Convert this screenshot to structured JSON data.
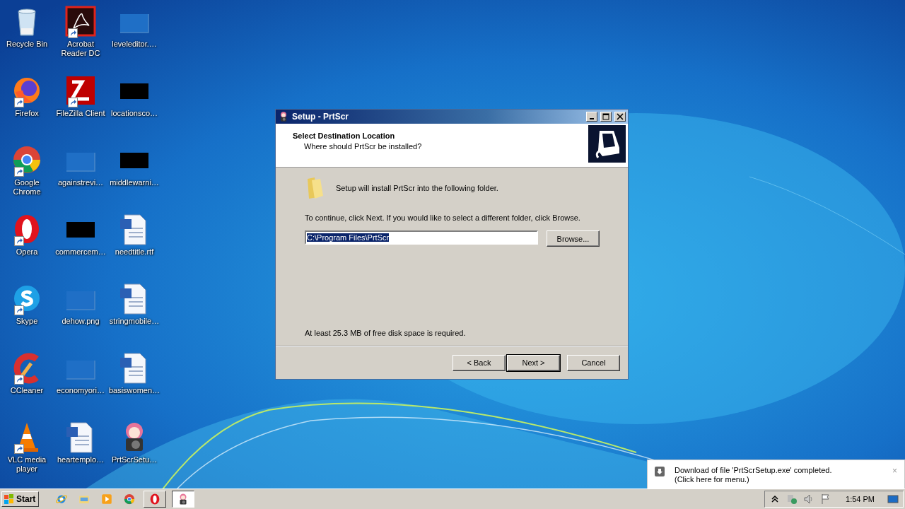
{
  "desktop_icons": [
    {
      "label": "Recycle Bin",
      "kind": "recycle",
      "shortcut": false
    },
    {
      "label": "Firefox",
      "kind": "firefox",
      "shortcut": true
    },
    {
      "label": "Google Chrome",
      "kind": "chrome",
      "shortcut": true
    },
    {
      "label": "Opera",
      "kind": "opera",
      "shortcut": true
    },
    {
      "label": "Skype",
      "kind": "skype",
      "shortcut": true
    },
    {
      "label": "CCleaner",
      "kind": "ccleaner",
      "shortcut": true
    },
    {
      "label": "VLC media player",
      "kind": "vlc",
      "shortcut": true
    },
    {
      "label": "Acrobat Reader DC",
      "kind": "acrobat",
      "shortcut": true
    },
    {
      "label": "FileZilla Client",
      "kind": "filezilla",
      "shortcut": true
    },
    {
      "label": "againstrevi…",
      "kind": "blank",
      "shortcut": false
    },
    {
      "label": "commercem…",
      "kind": "black",
      "shortcut": false
    },
    {
      "label": "dehow.png",
      "kind": "blank",
      "shortcut": false
    },
    {
      "label": "economyori…",
      "kind": "blank",
      "shortcut": false
    },
    {
      "label": "heartemplo…",
      "kind": "word",
      "shortcut": false
    },
    {
      "label": "leveleditor.…",
      "kind": "blank",
      "shortcut": false
    },
    {
      "label": "locationsco…",
      "kind": "black",
      "shortcut": false
    },
    {
      "label": "middlewarni…",
      "kind": "black",
      "shortcut": false
    },
    {
      "label": "needtitle.rtf",
      "kind": "word",
      "shortcut": false
    },
    {
      "label": "stringmobile…",
      "kind": "word",
      "shortcut": false
    },
    {
      "label": "basiswomen…",
      "kind": "word",
      "shortcut": false
    },
    {
      "label": "PrtScrSetu…",
      "kind": "prtscr",
      "shortcut": false
    }
  ],
  "dialog": {
    "title": "Setup - PrtScr",
    "heading": "Select Destination Location",
    "subheading": "Where should PrtScr be installed?",
    "intro": "Setup will install PrtScr into the following folder.",
    "instruction": "To continue, click Next. If you would like to select a different folder, click Browse.",
    "path_field": {
      "value": "C:\\Program Files\\PrtScr",
      "text_selected": true
    },
    "browse_button": "Browse...",
    "disk_note": "At least 25.3 MB of free disk space is required.",
    "buttons": [
      {
        "label": "< Back",
        "default": false
      },
      {
        "label": "Next >",
        "default": true
      },
      {
        "label": "Cancel",
        "default": false
      }
    ]
  },
  "notification": {
    "lines": [
      "Download of file 'PrtScrSetup.exe' completed.",
      "(Click here for menu.)"
    ],
    "close": "×"
  },
  "taskbar": {
    "start": "Start",
    "items": [
      {
        "kind": "ie",
        "running": false,
        "active": false
      },
      {
        "kind": "explorer",
        "running": false,
        "active": false
      },
      {
        "kind": "media",
        "running": false,
        "active": false
      },
      {
        "kind": "chrome",
        "running": false,
        "active": false
      },
      {
        "kind": "opera",
        "running": true,
        "active": false
      },
      {
        "kind": "prtscr",
        "running": true,
        "active": true
      }
    ],
    "clock": "1:54 PM"
  }
}
